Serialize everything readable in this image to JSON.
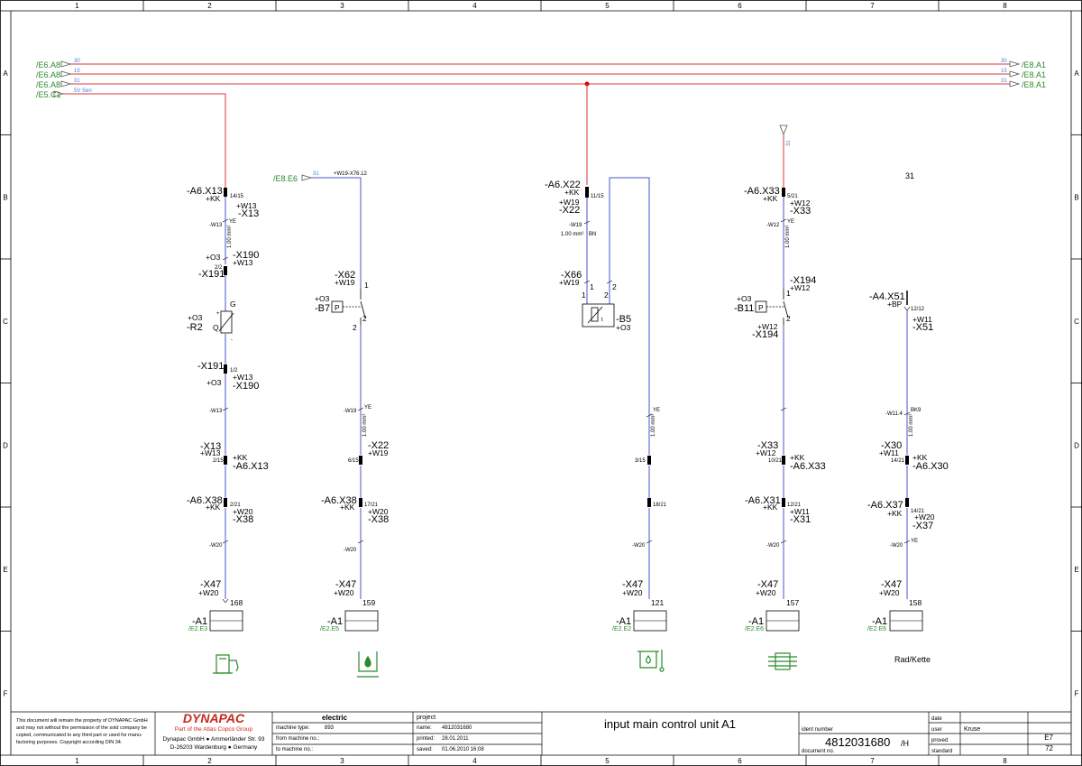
{
  "frame": {
    "cols": [
      "1",
      "2",
      "3",
      "4",
      "5",
      "6",
      "7",
      "8"
    ],
    "rows": [
      "A",
      "B",
      "C",
      "D",
      "E",
      "F"
    ]
  },
  "rails": {
    "left": [
      "/E6.A8",
      "/E6.A8",
      "/E6.A8",
      "/E5.C1"
    ],
    "right": [
      "/E8.A1",
      "/E8.A1",
      "/E8.A1"
    ],
    "wires_left": [
      "30",
      "15",
      "31",
      "5V Sen"
    ],
    "wires_right": [
      "30",
      "15",
      "31"
    ]
  },
  "c1": {
    "x13_top": "-A6.X13",
    "kk": "+KK",
    "pin": "14/15",
    "w13a": "+W13",
    "x13b": "-X13",
    "wlbl": "-W13",
    "ye": "YE",
    "sq": "1.00 mm²",
    "o3": "+O3",
    "x190": "-X190",
    "w13b": "+W13",
    "x191": "-X191",
    "p22": "2/2",
    "g": "G",
    "q": "Q",
    "plus": "+",
    "minus": "-",
    "o3b": "+O3",
    "r2": "-R2",
    "x191b": "-X191",
    "p12": "1/2",
    "w13c": "+W13",
    "o3c": "+O3",
    "x190b": "-X190",
    "wlbl2": "-W13",
    "x13c": "-X13",
    "w13d": "+W13",
    "kk2": "+KK",
    "p215": "2/15",
    "a6x13": "-A6.X13",
    "a6x38": "-A6.X38",
    "kk3": "+KK",
    "p221": "2/21",
    "w20": "+W20",
    "x38": "-X38",
    "wlbl3": "-W20",
    "x47": "-X47",
    "w20b": "+W20",
    "n": "168",
    "a1": "-A1",
    "ref": "/E2.E3"
  },
  "c2": {
    "src": "/E8.E6",
    "wire": "31",
    "w19ref": "+W19-X76.12",
    "x62": "-X62",
    "w19": "+W19",
    "p1": "1",
    "o3": "+O3",
    "b7": "-B7",
    "p": "P",
    "p2": "2",
    "p2b": "2",
    "wlbl": "-W19",
    "ye": "YE",
    "sq": "1.00 mm²",
    "x22": "-X22",
    "w19b": "+W19",
    "p615": "6/15",
    "a6x38": "-A6.X38",
    "kk": "+KK",
    "p1721": "17/21",
    "w20": "+W20",
    "x38": "-X38",
    "wlbl2": "-W20",
    "x47": "-X47",
    "w20b": "+W20",
    "n": "159",
    "a1": "-A1",
    "ref": "/E2.E5"
  },
  "c3": {
    "a6x22": "-A6.X22",
    "kk": "+KK",
    "p1115": "11/15",
    "w19": "+W19",
    "x22": "-X22",
    "wlbl": "-W19",
    "sq": "1.00 mm²",
    "bn": "BN",
    "x66": "-X66",
    "w19b": "+W19",
    "p1": "1",
    "p2": "2",
    "b5": "-B5",
    "o3": "+O3",
    "t": "t",
    "ye": "YE",
    "p315": "3/15",
    "p1821": "18/21",
    "wlbl2": "-W20",
    "x47": "-X47",
    "w20": "+W20",
    "n": "121",
    "a1": "-A1",
    "ref": "/E2.E2"
  },
  "c4": {
    "wire": "31",
    "a6x33": "-A6.X33",
    "kk": "+KK",
    "p521": "5/21",
    "w12": "+W12",
    "x33": "-X33",
    "wlbl": "-W12",
    "ye": "YE",
    "sq": "1.00 mm²",
    "x194": "-X194",
    "w12b": "+W12",
    "p1": "1",
    "o3": "+O3",
    "b11": "-B11",
    "p": "P",
    "p2": "2",
    "w12c": "+W12",
    "x194b": "-X194",
    "x33b": "-X33",
    "w12d": "+W12",
    "kk2": "+KK",
    "p1021": "10/21",
    "a6x33b": "-A6.X33",
    "a6x31": "-A6.X31",
    "kk3": "+KK",
    "p1221": "12/21",
    "w11": "+W11",
    "x31": "-X31",
    "wlbl3": "-W20",
    "x47": "-X47",
    "w20": "+W20",
    "n": "157",
    "a1": "-A1",
    "ref": "/E2.E6"
  },
  "c5": {
    "top": "31",
    "a4x51": "-A4.X51",
    "bp": "+BP",
    "p1212": "12/12",
    "w11": "+W11",
    "x51": "-X51",
    "wlbl": "-W11.4",
    "bk": "BK9",
    "sq": "1.00 mm²",
    "x30": "-X30",
    "w11b": "+W11",
    "kk": "+KK",
    "p1421": "14/21",
    "a6x30": "-A6.X30",
    "a6x37": "-A6.X37",
    "kk2": "+KK",
    "p1421b": "14/21",
    "w20": "+W20",
    "x37": "-X37",
    "wlbl2": "-W20",
    "ye": "YE",
    "x47": "-X47",
    "w20b": "+W20",
    "n": "158",
    "a1": "-A1",
    "ref": "/E2.E6",
    "caption": "Rad/Kette"
  },
  "titleblock": {
    "notice": "This document will remain the property of DYNAPAC GmbH and may not without the permission of the sold company be copied, communicated to any third part or used for manufactoring purposes. Copyright according DIN 34.",
    "brand": "DYNAPAC",
    "subbrand": "Part of the Atlas Copco Group",
    "address1": "Dynapac GmbH ● Ammerländer Str. 93",
    "address2": "D-26203 Wardenburg ● Germany",
    "electric": "electric",
    "machine_type_label": "machine type:",
    "machine_type": "893",
    "from_machine_label": "from machine no.:",
    "to_machine_label": "to machine no.:",
    "project": "project",
    "name_label": "name:",
    "name": "4812031680",
    "printed_label": "printed:",
    "printed": "28.01.2011",
    "saved_label": "saved:",
    "saved": "01.06.2010 16:08",
    "title": "input main control unit A1",
    "ident_label": "ident number",
    "doc_number": "4812031680",
    "doc_suffix": "/H",
    "doc_label": "document no.",
    "date_label": "date",
    "user_label": "user",
    "user": "Kruse",
    "proved_label": "proved",
    "standard_label": "standard",
    "sheet": "E7",
    "sheets": "72"
  }
}
